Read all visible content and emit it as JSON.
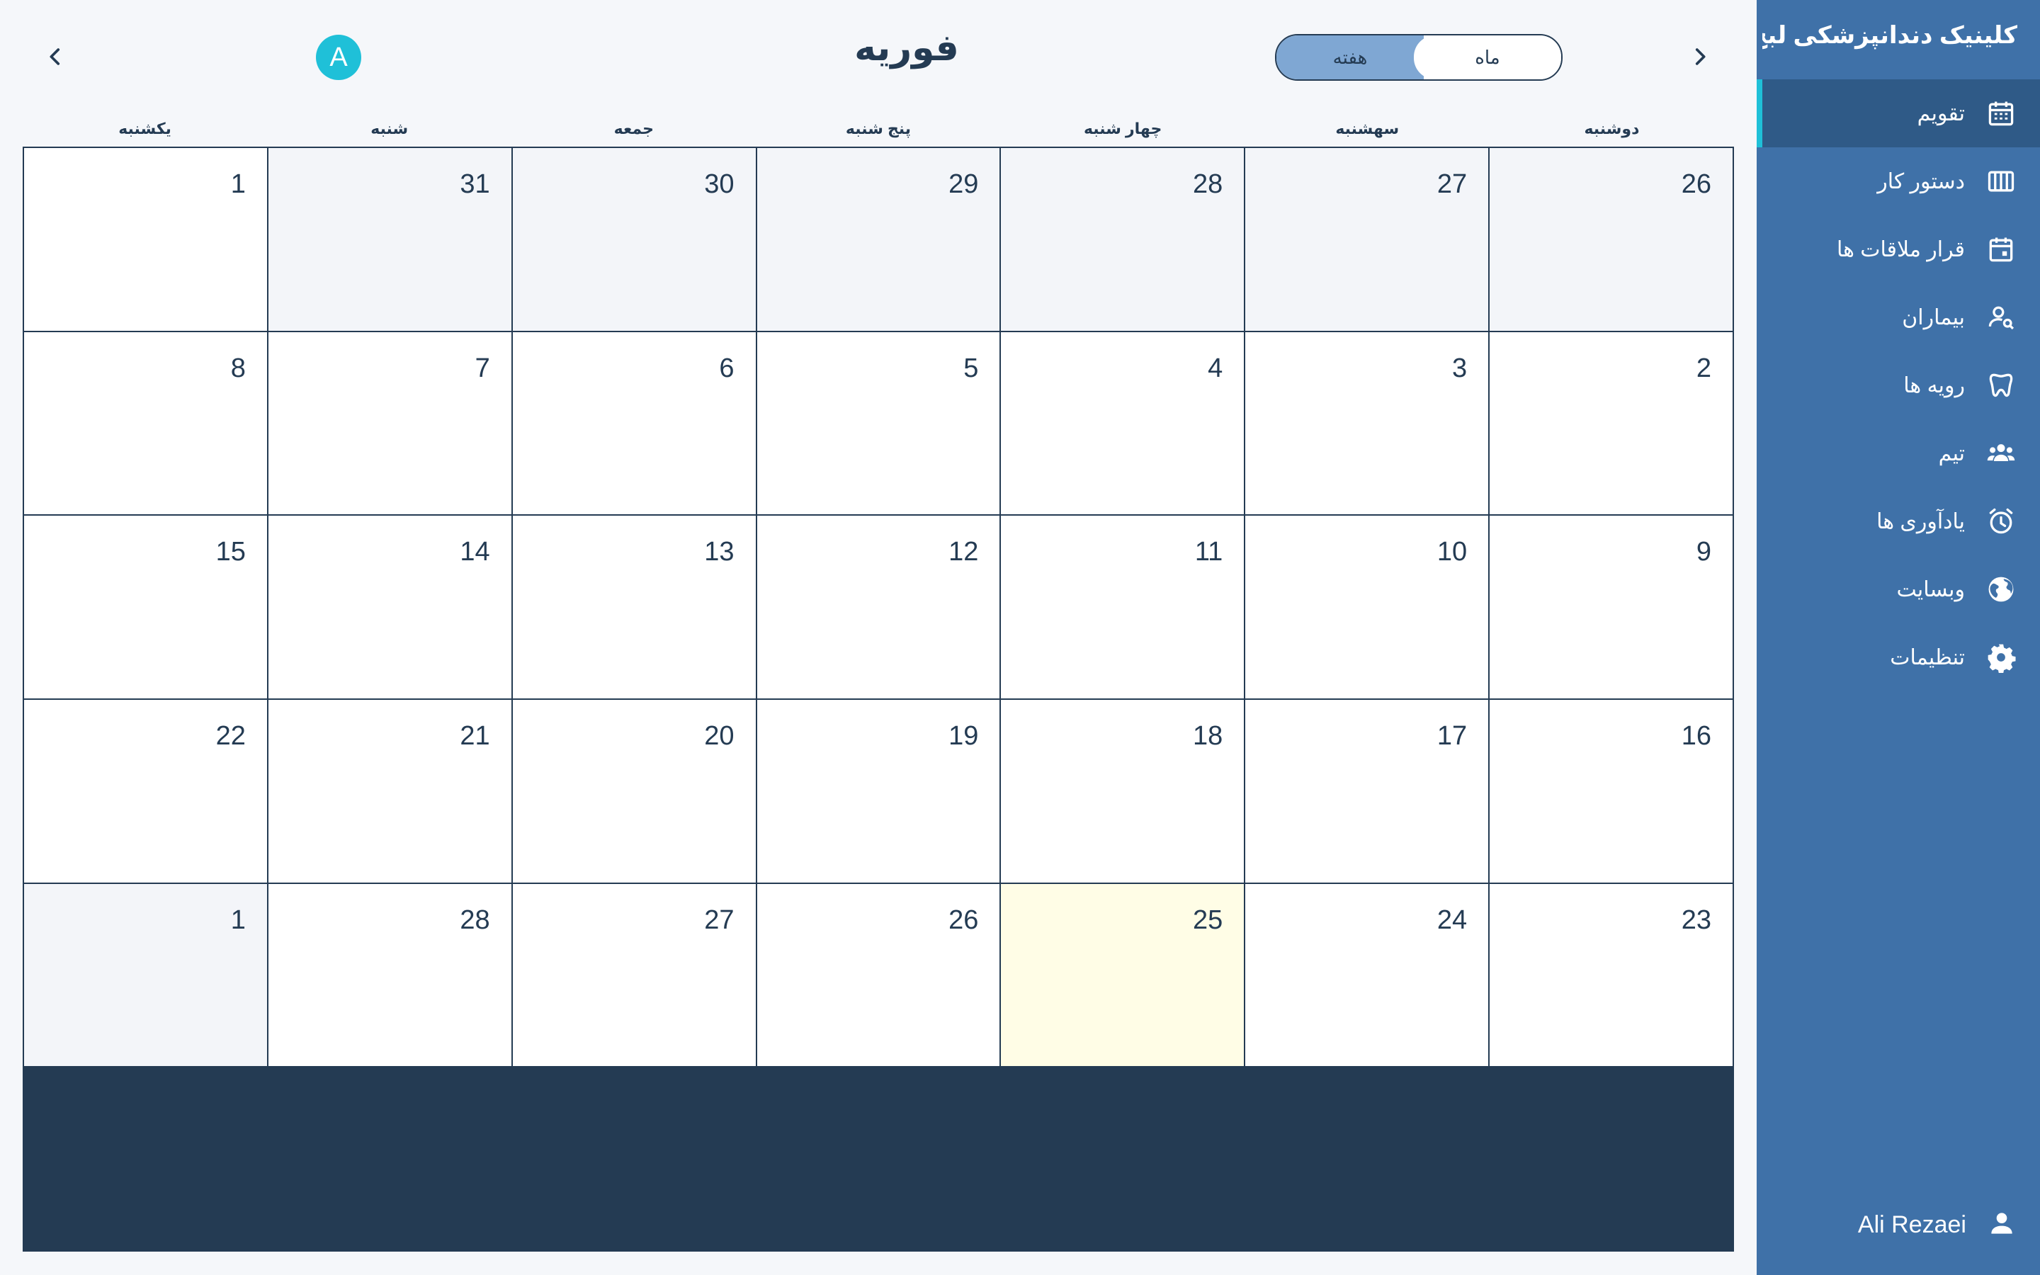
{
  "header": {
    "month_title": "فوریه",
    "avatar_letter": "A",
    "view_toggle": {
      "month_label": "ماه",
      "week_label": "هفته",
      "selected": "week"
    }
  },
  "weekdays": [
    "یکشنبه",
    "شنبه",
    "جمعه",
    "پنج شنبه",
    "چهار شنبه",
    "سهشنبه",
    "دوشنبه"
  ],
  "weeks": [
    [
      "1",
      "31",
      "30",
      "29",
      "28",
      "27",
      "26"
    ],
    [
      "8",
      "7",
      "6",
      "5",
      "4",
      "3",
      "2"
    ],
    [
      "15",
      "14",
      "13",
      "12",
      "11",
      "10",
      "9"
    ],
    [
      "22",
      "21",
      "20",
      "19",
      "18",
      "17",
      "16"
    ],
    [
      "1",
      "28",
      "27",
      "26",
      "25",
      "24",
      "23"
    ]
  ],
  "sidebar": {
    "clinic_name": "کلینیک دندانپزشکی لبخ...",
    "items": [
      {
        "label": "تقویم",
        "icon": "calendar-icon"
      },
      {
        "label": "دستور کار",
        "icon": "columns-icon"
      },
      {
        "label": "قرار ملاقات ها",
        "icon": "calendar-event-icon"
      },
      {
        "label": "بیماران",
        "icon": "user-search-icon"
      },
      {
        "label": "رویه ها",
        "icon": "tooth-icon"
      },
      {
        "label": "تیم",
        "icon": "team-icon"
      },
      {
        "label": "یادآوری ها",
        "icon": "alarm-icon"
      },
      {
        "label": "وبسایت",
        "icon": "globe-icon"
      },
      {
        "label": "تنظیمات",
        "icon": "gear-icon"
      }
    ],
    "user_name": "Ali Rezaei"
  },
  "colors": {
    "sidebar_bg": "#3f71a8",
    "sidebar_active": "#2f5a87",
    "accent": "#1fc0d8",
    "today_bg": "#fffde6",
    "toggle_active": "#7fa7d3",
    "text": "#243b53"
  }
}
